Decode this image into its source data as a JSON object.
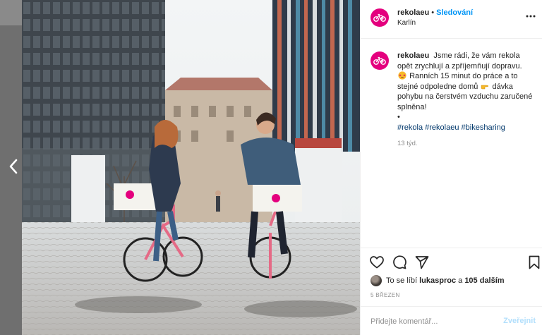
{
  "post": {
    "username": "rekolaeu",
    "separator": "•",
    "follow_label": "Sledování",
    "location": "Karlín",
    "caption": {
      "username": "rekolaeu",
      "line1": "Jsme rádi, že vám rekola opět zrychlují a zpříjemňují dopravu.",
      "line2": "Ranních 15 minut do práce a to stejné odpoledne domů",
      "line3": "dávka pohybu na čerstvém vzduchu zaručené splněna!",
      "bullet": "•",
      "hashtags": [
        "#rekola",
        "#rekolaeu",
        "#bikesharing"
      ]
    },
    "age": "13 týd.",
    "likes": {
      "prefix": "To se líbí",
      "user": "lukasproc",
      "joiner": "a",
      "others": "105 dalším"
    },
    "date": "5 březen",
    "comment_placeholder": "Přidejte komentář...",
    "post_button": "Zveřejnit"
  },
  "icons": {
    "prev": "chevron-left-icon",
    "more": "more-horizontal-icon",
    "like": "heart-icon",
    "comment": "comment-icon",
    "share": "paper-plane-icon",
    "save": "bookmark-icon",
    "avatar": "bicycle-logo-icon",
    "emoji1": "star-struck-emoji",
    "emoji2": "backhand-pointing-right-emoji"
  },
  "colors": {
    "brand": "#e4007e",
    "follow": "#0095f6",
    "hashtag": "#00376b",
    "post_button_disabled": "#b2dffc"
  }
}
